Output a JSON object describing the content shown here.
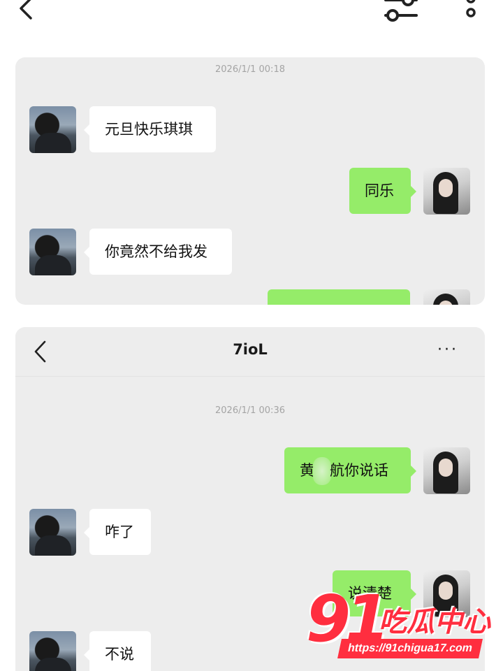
{
  "top_bar": {
    "back_icon": "chevron-left-icon",
    "filter_icon": "sliders-icon",
    "more_icon": "more-vertical-icon"
  },
  "screenshot_1": {
    "timestamp": "2026/1/1 00:18",
    "messages": [
      {
        "side": "left",
        "text": "元旦快乐琪琪"
      },
      {
        "side": "right",
        "text": "同乐"
      },
      {
        "side": "left",
        "text": "你竟然不给我发"
      },
      {
        "side": "right",
        "text": ""
      }
    ]
  },
  "screenshot_2": {
    "title": "7ioL",
    "more_label": "···",
    "timestamp": "2026/1/1 00:36",
    "messages": [
      {
        "side": "right",
        "text_before": "黄",
        "text_after": "航你说话"
      },
      {
        "side": "left",
        "text": "咋了"
      },
      {
        "side": "right",
        "text": "说清楚"
      },
      {
        "side": "left",
        "text": "不说"
      }
    ]
  },
  "watermark": {
    "number": "91",
    "text": "吃瓜中心",
    "url": "https://91chigua17.com"
  },
  "colors": {
    "chat_background": "#ededed",
    "right_bubble": "#95ec69",
    "left_bubble": "#ffffff",
    "watermark_red": "#ff2e3f"
  }
}
